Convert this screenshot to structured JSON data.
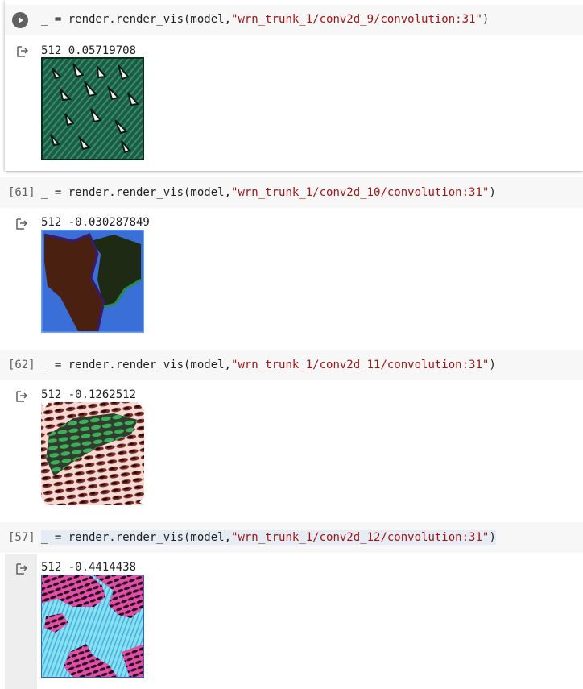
{
  "cells": [
    {
      "prompt": "",
      "code_prefix": "_ = render.render_vis(model,",
      "code_string": "\"wrn_trunk_1/conv2d_9/convolution:31\"",
      "code_suffix": ")",
      "output_text": "512 0.05719708",
      "icon": "output-redirect-icon"
    },
    {
      "prompt": "[61]",
      "code_prefix": "_ = render.render_vis(model,",
      "code_string": "\"wrn_trunk_1/conv2d_10/convolution:31\"",
      "code_suffix": ")",
      "output_text": "512 -0.030287849",
      "icon": "output-redirect-icon"
    },
    {
      "prompt": "[62]",
      "code_prefix": "_ = render.render_vis(model,",
      "code_string": "\"wrn_trunk_1/conv2d_11/convolution:31\"",
      "code_suffix": ")",
      "output_text": "512 -0.1262512",
      "icon": "output-redirect-icon"
    },
    {
      "prompt": "[57]",
      "code_prefix": "_ = render.render_vis(model,",
      "code_string": "\"wrn_trunk_1/conv2d_12/convolution:31\"",
      "code_suffix": ")",
      "output_text": "512 -0.4414438",
      "icon": "output-redirect-icon"
    }
  ],
  "colors": {
    "code_bg": "#f7f7f7",
    "string": "#a31515",
    "prompt": "#616161"
  }
}
